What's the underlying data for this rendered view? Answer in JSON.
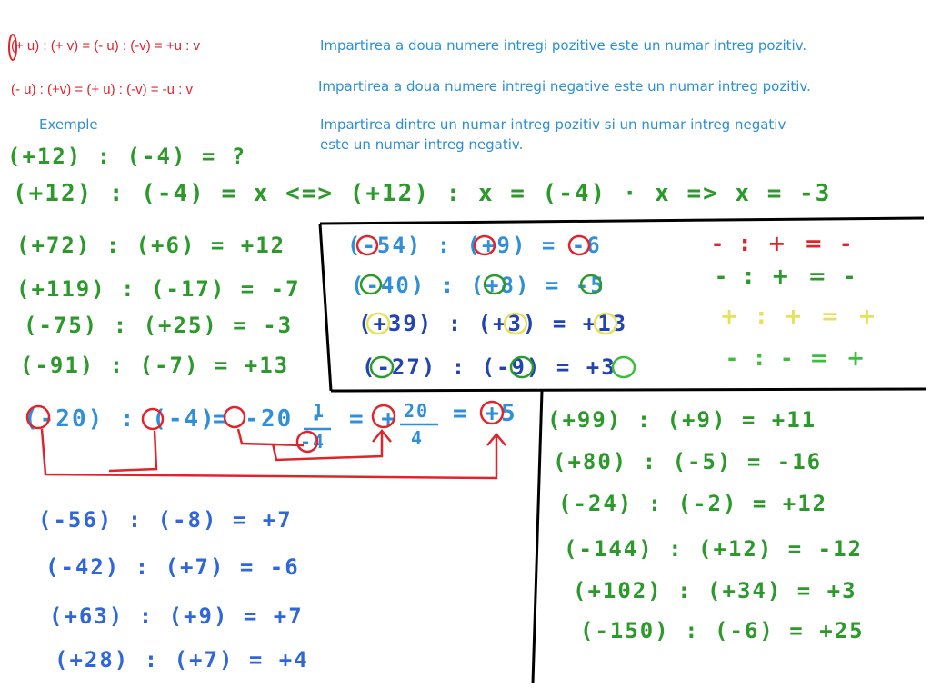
{
  "rules": {
    "r1": {
      "formula": "(+ u) : (+ v) = (- u) : (-v) =  +u  :  v",
      "text": "Impartirea a doua numere intregi pozitive este un numar intreg pozitiv."
    },
    "r2": {
      "formula": "(- u) : (+v)  = (+ u) : (-v) =  -u  :  v",
      "text": "Impartirea a doua numere intregi negative este un numar intreg pozitiv."
    },
    "r3": {
      "text1": "Impartirea dintre un numar intreg pozitiv si un numar intreg negativ",
      "text2": "este un numar intreg negativ."
    }
  },
  "examples_label": "Exemple",
  "intro": {
    "q": "(+12) : (-4) = ?",
    "work": "(+12) : (-4) = x <=> (+12) : x = (-4) · x  => x = -3"
  },
  "green_left": [
    "(+72) : (+6) = +12",
    "(+119) : (-17) = -7",
    "(-75) : (+25) = -3",
    "(-91) : (-7) = +13"
  ],
  "boxed": [
    {
      "text": "(-54) : (+9) = -6",
      "color": "#2f8fd8"
    },
    {
      "text": "(-40) : (+8) = -5",
      "color": "#2f8fd8"
    },
    {
      "text": "(+39) : (+3) = +13",
      "color": "#2244b0"
    },
    {
      "text": "(-27) : (-9) = +3",
      "color": "#2244b0"
    }
  ],
  "sign_rules": [
    {
      "text": "- : + = -",
      "color": "#e0242c"
    },
    {
      "text": "- : + = -",
      "color": "#2b9a2b"
    },
    {
      "text": "+ : + = +",
      "color": "#e6e05a"
    },
    {
      "text": "- : - = +",
      "color": "#3bbf3b"
    }
  ],
  "fraction": {
    "left": "(-20) : (-4)",
    "eq1": "= -20 ·",
    "num1": "1",
    "den1": "-4",
    "eq2": "= +",
    "num2": "20",
    "den2": "4",
    "eq3": "= +5"
  },
  "blue_bottom": [
    "(-56) : (-8) = +7",
    "(-42) : (+7) = -6",
    "(+63) : (+9) = +7",
    "(+28) : (+7) = +4"
  ],
  "green_right": [
    "(+99) : (+9) = +11",
    "(+80) : (-5) = -16",
    "(-24) : (-2) = +12",
    "(-144) : (+12) = -12",
    "(+102) : (+34) = +3",
    "(-150) : (-6) = +25"
  ]
}
